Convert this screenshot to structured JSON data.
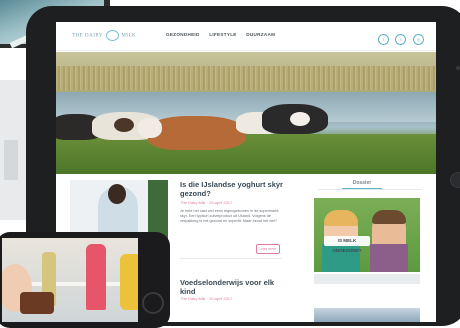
{
  "site": {
    "logo_text_left": "THE DAIRY",
    "logo_text_right": "MILK",
    "nav": [
      "GEZONDHEID",
      "LIFESTYLE",
      "DUURZAAM"
    ],
    "social_icons": [
      "facebook-icon",
      "twitter-icon",
      "instagram-icon"
    ]
  },
  "article1": {
    "title": "Is die IJslandse yoghurt skyr gezond?",
    "meta": "The Dairy Milk · 25 april 2017",
    "excerpt": "Je hebt het vast wel eens tegengekomen in de supermarkt: skyr. Een typisch zuivelproduct uit IJsland. Volgens de verpakking is het gezond en superfit. Maar bevat het wel?",
    "read_more": "Lees meer"
  },
  "article2": {
    "title": "Voedselonderwijs voor elk kind",
    "meta": "The Dairy Milk · 20 april 2017"
  },
  "sidebar": {
    "heading": "Dossier",
    "badge": "IS MELK ONGEZOND?"
  },
  "colors": {
    "accent": "#5fb3c7",
    "pink": "#e07ba5",
    "tablet_frame": "#1e1f21"
  }
}
